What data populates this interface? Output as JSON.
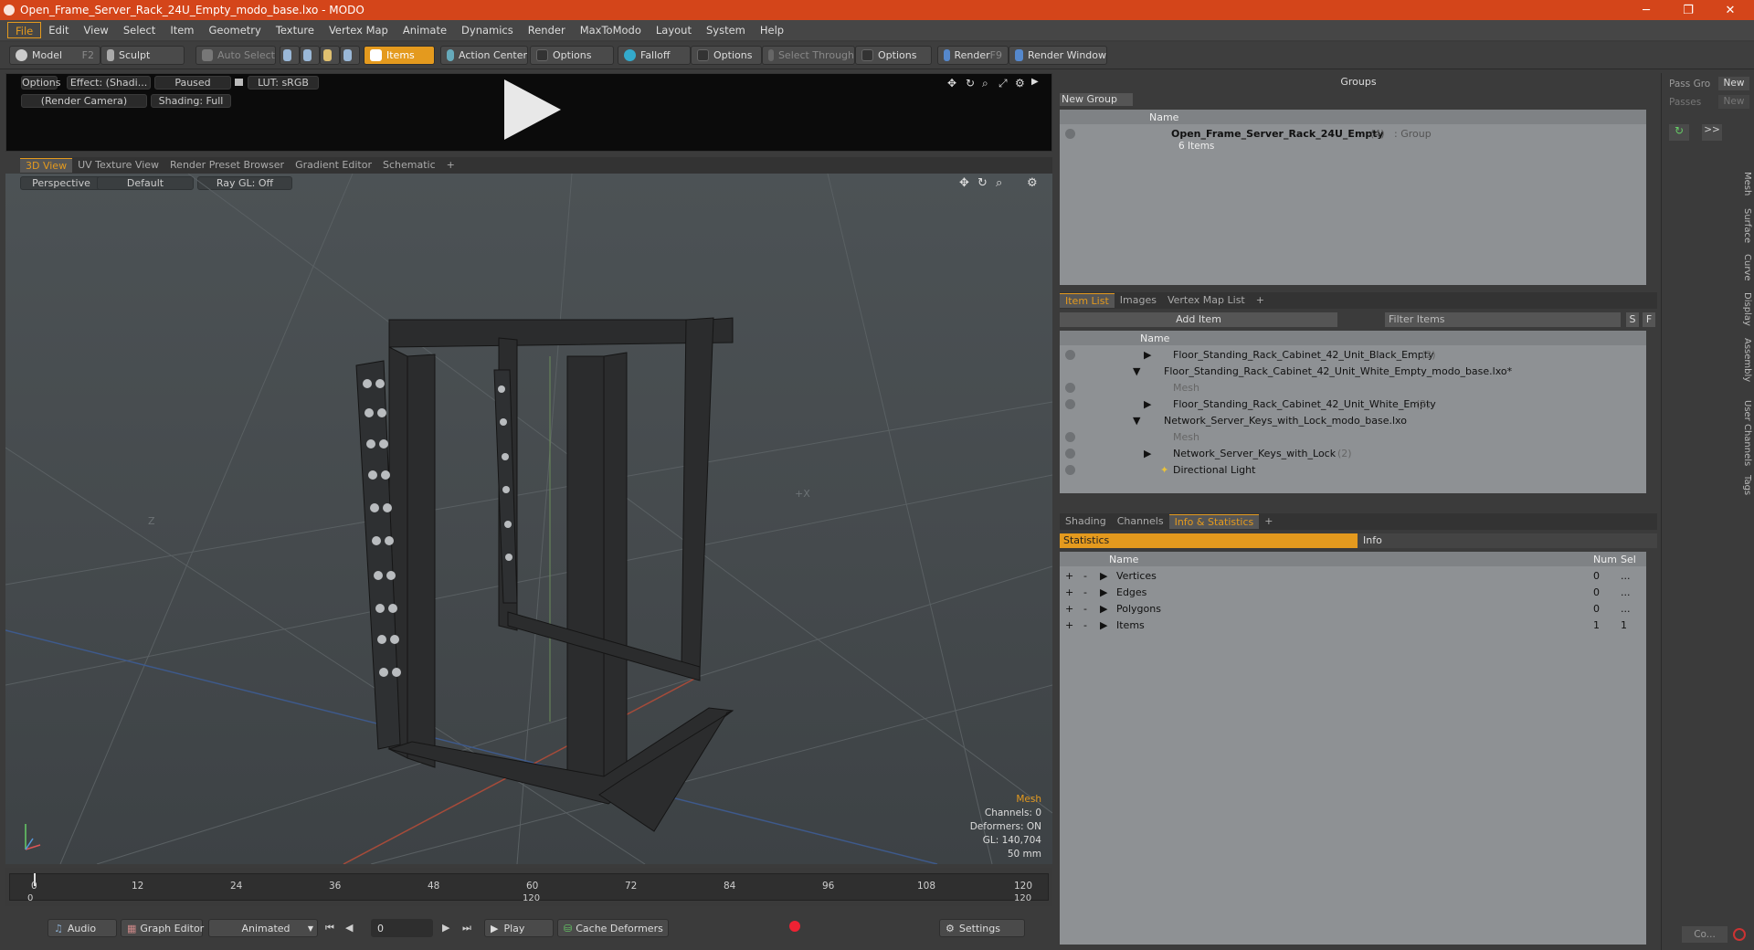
{
  "window": {
    "title": "Open_Frame_Server_Rack_24U_Empty_modo_base.lxo - MODO",
    "minimize": "─",
    "restore": "❐",
    "close": "✕"
  },
  "menu": [
    "File",
    "Edit",
    "View",
    "Select",
    "Item",
    "Geometry",
    "Texture",
    "Vertex Map",
    "Animate",
    "Dynamics",
    "Render",
    "MaxToModo",
    "Layout",
    "System",
    "Help"
  ],
  "toolbar": {
    "model": "Model",
    "model_key": "F2",
    "sculpt": "Sculpt",
    "auto_select": "Auto Select",
    "items": "Items",
    "action_center": "Action Center",
    "options1": "Options",
    "falloff": "Falloff",
    "options2": "Options",
    "select_through": "Select Through",
    "options3": "Options",
    "render": "Render",
    "render_key": "F9",
    "render_window": "Render Window"
  },
  "preview": {
    "options": "Options",
    "effect": "Effect: (Shadi...",
    "paused": "Paused",
    "lut": "LUT: sRGB",
    "camera": "(Render Camera)",
    "shading": "Shading: Full"
  },
  "view_tabs": [
    "3D View",
    "UV Texture View",
    "Render Preset Browser",
    "Gradient Editor",
    "Schematic",
    "+"
  ],
  "viewport": {
    "perspective": "Perspective",
    "default": "Default",
    "raygl": "Ray GL: Off",
    "axis_z": "Z",
    "axis_x": "+X",
    "info": {
      "mesh": "Mesh",
      "channels": "Channels: 0",
      "deformers": "Deformers: ON",
      "gl": "GL: 140,704",
      "mm": "50 mm"
    }
  },
  "timeline": {
    "ticks": [
      "0",
      "12",
      "24",
      "36",
      "48",
      "60",
      "72",
      "84",
      "96",
      "108",
      "120"
    ],
    "bottom_left": "0",
    "bottom_mid": "120",
    "bottom_right": "120"
  },
  "bottombar": {
    "audio": "Audio",
    "graph_editor": "Graph Editor",
    "animated": "Animated",
    "frame": "0",
    "play": "Play",
    "cache": "Cache Deformers",
    "settings": "Settings"
  },
  "groups": {
    "title": "Groups",
    "new_group": "New Group",
    "col_name": "Name",
    "group_name": "Open_Frame_Server_Rack_24U_Empty",
    "group_count": "(4)",
    "group_type": ": Group",
    "group_items": "6 Items"
  },
  "item_list": {
    "tabs": [
      "Item List",
      "Images",
      "Vertex Map List",
      "+"
    ],
    "add_item": "Add Item",
    "filter": "Filter Items",
    "s": "S",
    "f": "F",
    "col_name": "Name",
    "rows": [
      {
        "label": "Floor_Standing_Rack_Cabinet_42_Unit_Black_Empty",
        "count": "(2)"
      },
      {
        "label": "Floor_Standing_Rack_Cabinet_42_Unit_White_Empty_modo_base.lxo*",
        "count": ""
      },
      {
        "label": "Mesh",
        "count": ""
      },
      {
        "label": "Floor_Standing_Rack_Cabinet_42_Unit_White_Empty",
        "count": "(2)"
      },
      {
        "label": "Network_Server_Keys_with_Lock_modo_base.lxo",
        "count": ""
      },
      {
        "label": "Mesh",
        "count": ""
      },
      {
        "label": "Network_Server_Keys_with_Lock",
        "count": "(2)"
      },
      {
        "label": "Directional Light",
        "count": ""
      }
    ]
  },
  "stats": {
    "tabs": [
      "Shading",
      "Channels",
      "Info & Statistics",
      "+"
    ],
    "statistics": "Statistics",
    "info": "Info",
    "col_name": "Name",
    "col_num": "Num",
    "col_sel": "Sel",
    "rows": [
      {
        "name": "Vertices",
        "num": "0",
        "sel": "..."
      },
      {
        "name": "Edges",
        "num": "0",
        "sel": "..."
      },
      {
        "name": "Polygons",
        "num": "0",
        "sel": "..."
      },
      {
        "name": "Items",
        "num": "1",
        "sel": "1"
      }
    ]
  },
  "right": {
    "pass_group": "Pass Gro",
    "passes": "Passes",
    "new1": "New",
    "new2": "New",
    "arrows": ">>",
    "vtabs": [
      "Mesh",
      "Surface",
      "Curve",
      "Display",
      "Assembly",
      "User Channels",
      "Tags"
    ],
    "co": "Co..."
  }
}
